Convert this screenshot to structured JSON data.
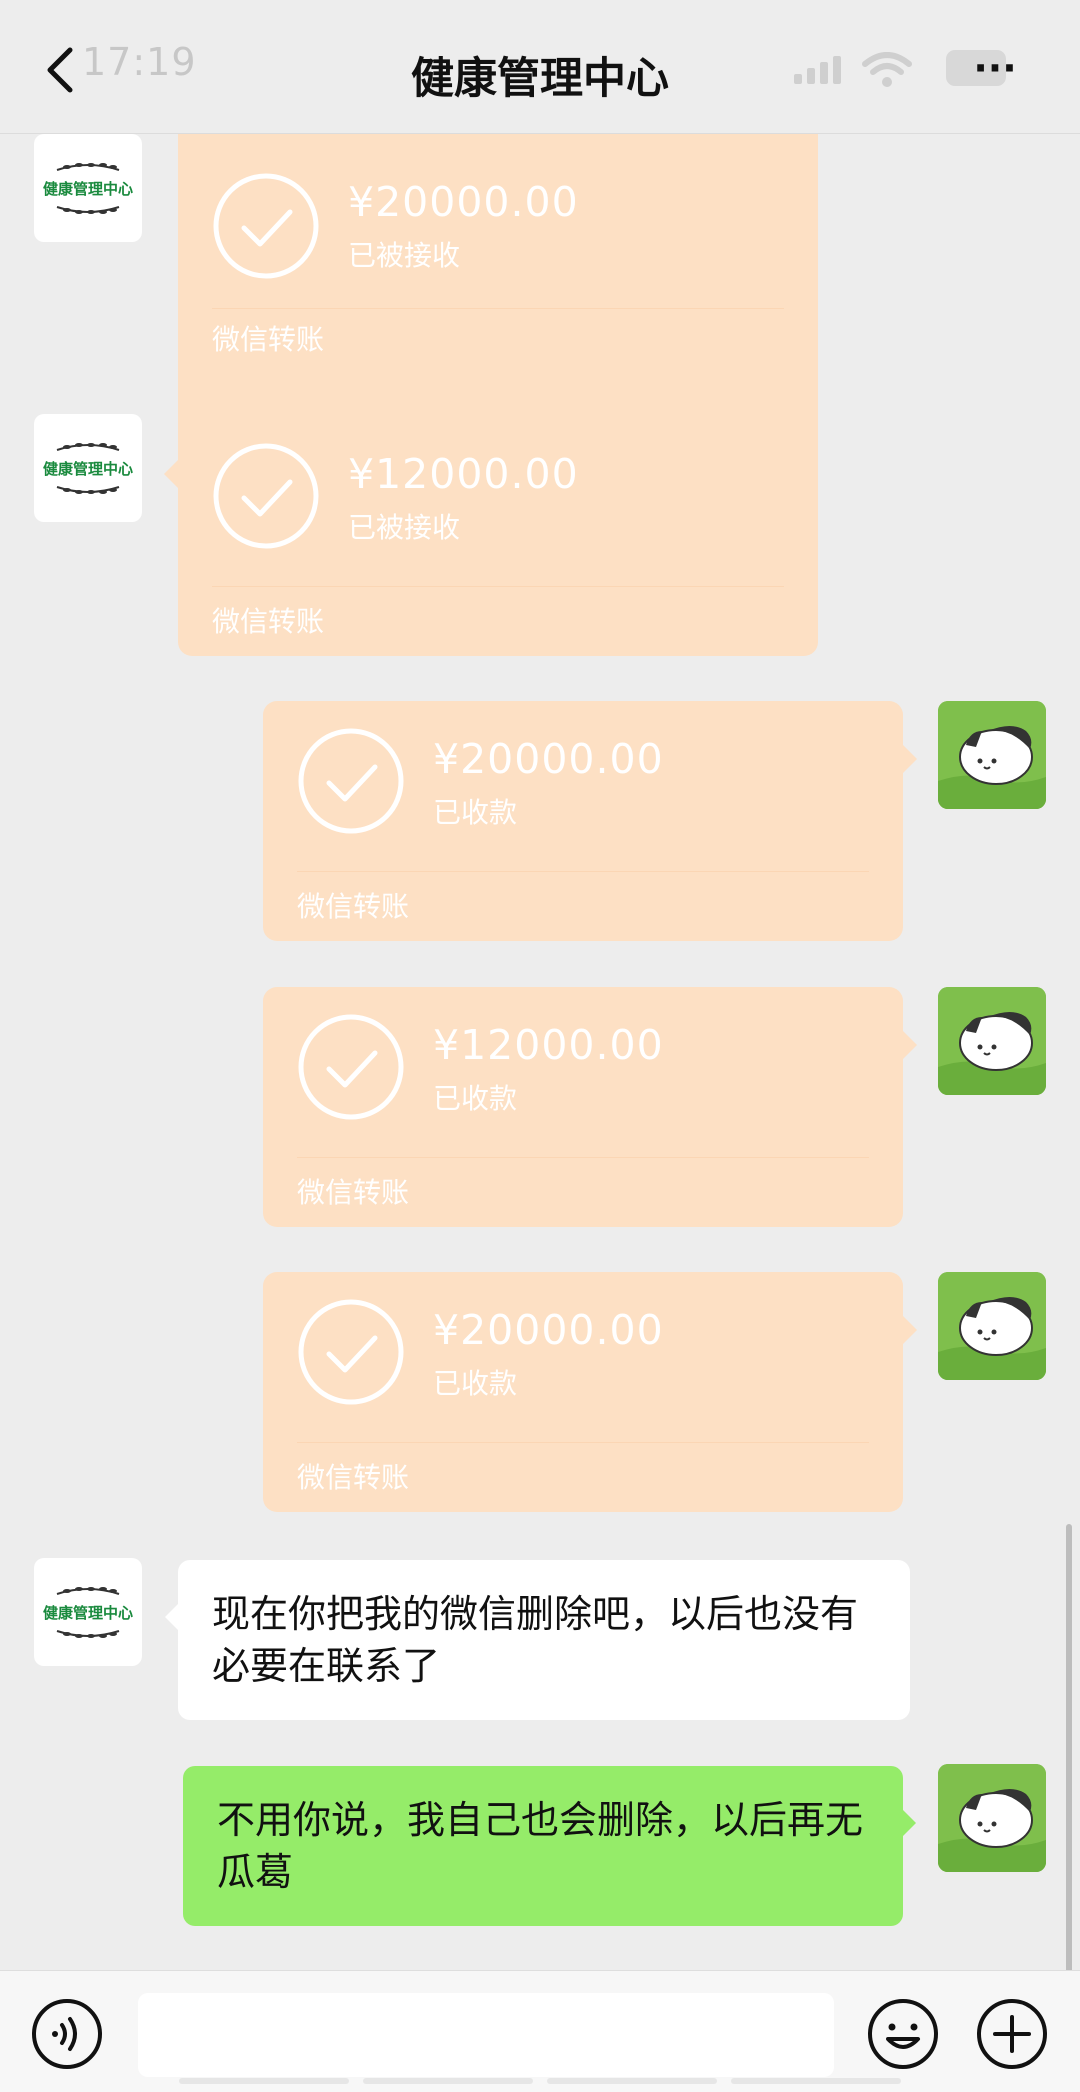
{
  "status_bar": {
    "time": "17:19",
    "battery": "5"
  },
  "header": {
    "title": "健康管理中心",
    "more_label": "···"
  },
  "org_avatar": {
    "name": "健康管理中心"
  },
  "messages": [
    {
      "type": "transfer",
      "side": "left",
      "amount": "¥20000.00",
      "status": "已被接收",
      "label": "微信转账"
    },
    {
      "type": "transfer",
      "side": "left",
      "amount": "¥12000.00",
      "status": "已被接收",
      "label": "微信转账"
    },
    {
      "type": "transfer",
      "side": "right",
      "amount": "¥20000.00",
      "status": "已收款",
      "label": "微信转账"
    },
    {
      "type": "transfer",
      "side": "right",
      "amount": "¥12000.00",
      "status": "已收款",
      "label": "微信转账"
    },
    {
      "type": "transfer",
      "side": "right",
      "amount": "¥20000.00",
      "status": "已收款",
      "label": "微信转账"
    },
    {
      "type": "text",
      "side": "left",
      "text": "现在你把我的微信删除吧，以后也没有必要在联系了"
    },
    {
      "type": "text",
      "side": "right",
      "text": "不用你说，我自己也会删除，以后再无瓜葛"
    }
  ],
  "colors": {
    "transfer_bg": "#fde0c4",
    "my_bubble": "#95ec69",
    "org_green": "#1a8a3e"
  }
}
